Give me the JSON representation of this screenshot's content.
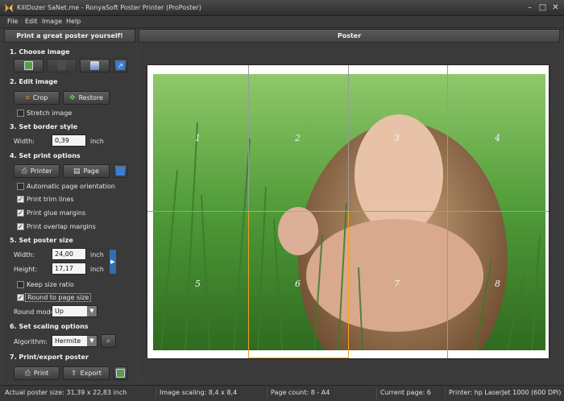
{
  "window": {
    "title": "KillDozer SaNet.me - RonyaSoft Poster Printer (ProPoster)",
    "min": "–",
    "max": "□",
    "close": "✕"
  },
  "menu": [
    "File",
    "Edit",
    "Image",
    "Help"
  ],
  "left": {
    "header": "Print a great poster yourself!",
    "s1": "1. Choose image",
    "s2": "2. Edit image",
    "crop": "Crop",
    "restore": "Restore",
    "stretch": "Stretch image",
    "s3": "3. Set border style",
    "border_width_label": "Width:",
    "border_width": "0,39",
    "border_unit": "inch",
    "s4": "4. Set print options",
    "printer": "Printer",
    "page": "Page",
    "auto_orient": "Automatic page orientation",
    "trim": "Print trim lines",
    "glue": "Print glue margins",
    "overlap": "Print overlap margins",
    "s5": "5. Set poster size",
    "width_label": "Width:",
    "width": "24,00",
    "width_unit": "inch",
    "height_label": "Height:",
    "height": "17,17",
    "height_unit": "inch",
    "keep_ratio": "Keep size ratio",
    "round_page": "Round to page size",
    "round_mode_label": "Round mode:",
    "round_mode": "Up",
    "s6": "6. Set scaling options",
    "algorithm_label": "Algorithm:",
    "algorithm": "Hermite",
    "s7": "7. Print/export poster",
    "print": "Print",
    "export": "Export"
  },
  "preview": {
    "header": "Poster",
    "pages": [
      "1",
      "2",
      "3",
      "4",
      "5",
      "6",
      "7",
      "8"
    ]
  },
  "status": {
    "actual": "Actual poster size: 31,39 x 22,83 inch",
    "scaling": "Image scaling: 8,4 x 8,4",
    "count": "Page count: 8 - A4",
    "current": "Current page: 6",
    "printer": "Printer: hp LaserJet 1000 (600 DPI)"
  },
  "colors": {
    "highlight": "#f0a020",
    "accent": "#2f6fb8"
  }
}
